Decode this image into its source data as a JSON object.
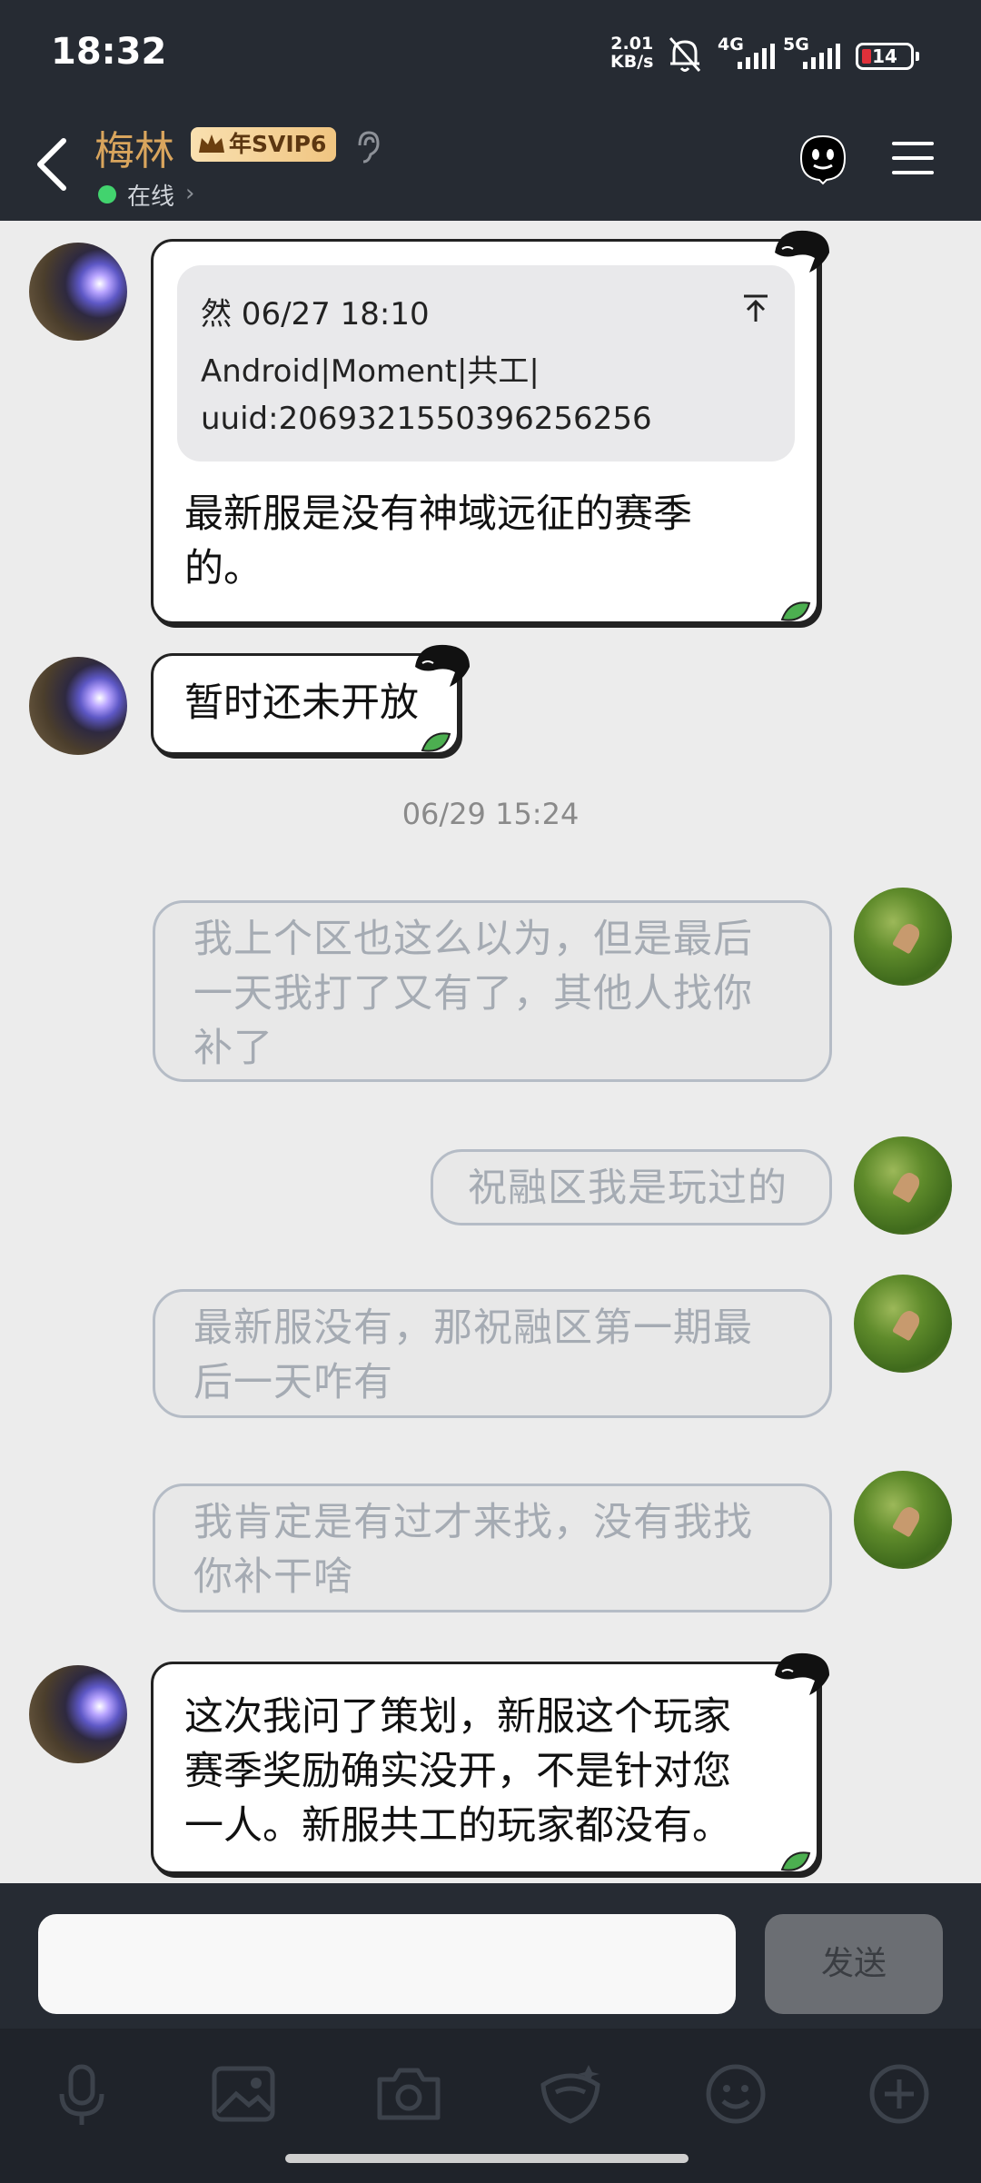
{
  "status_bar": {
    "time": "18:32",
    "net_speed_value": "2.01",
    "net_speed_unit": "KB/s",
    "signal_4g": "4G",
    "signal_5g": "5G",
    "battery": "14"
  },
  "header": {
    "contact_name": "梅林",
    "svip_badge": "年SVIP6",
    "status": "在线"
  },
  "messages": [
    {
      "quote_author_time": "然 06/27 18:10",
      "quote_line1": "Android|Moment|共工|",
      "quote_line2": "uuid:2069321550396256256",
      "line1": "最新服是没有神域远征的赛季",
      "line2": "的。"
    },
    {
      "line1": "暂时还未开放"
    },
    {
      "line1": "我上个区也这么以为，但是最后",
      "line2": "一天我打了又有了，其他人找你",
      "line3": "补了"
    },
    {
      "line1": "祝融区我是玩过的"
    },
    {
      "line1": "最新服没有，那祝融区第一期最",
      "line2": "后一天咋有"
    },
    {
      "line1": "我肯定是有过才来找，没有我找",
      "line2": "你补干啥"
    },
    {
      "line1": "这次我问了策划，新服这个玩家",
      "line2": "赛季奖励确实没开，不是针对您",
      "line3": "一人。新服共工的玩家都没有。"
    }
  ],
  "timestamp": "06/29 15:24",
  "input": {
    "value": "",
    "send_label": "发送"
  },
  "toolbar": [
    "mic-icon",
    "image-icon",
    "camera-icon",
    "redpacket-icon",
    "emoji-icon",
    "plus-icon"
  ],
  "colors": {
    "header_bg": "#262b33",
    "name": "#d9a55d",
    "online": "#42d36e",
    "chat_bg": "#ececec"
  }
}
